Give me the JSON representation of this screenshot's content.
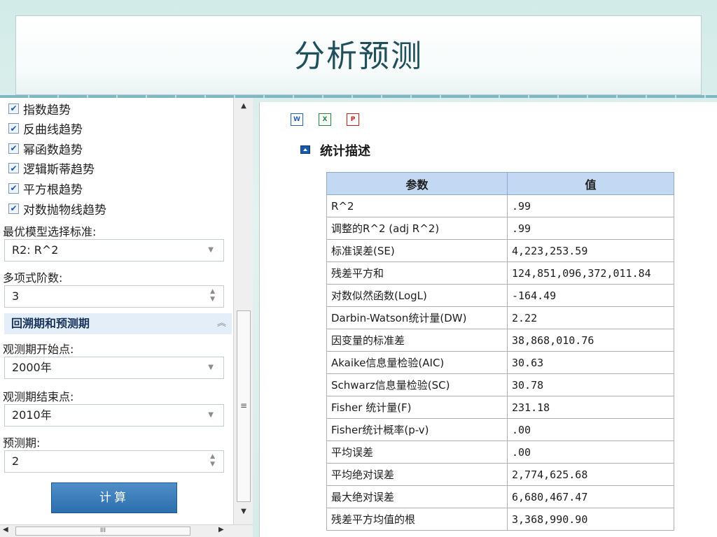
{
  "slide": {
    "title": "分析预测"
  },
  "left_panel": {
    "checkboxes": [
      {
        "label": "指数趋势",
        "checked": true
      },
      {
        "label": "反曲线趋势",
        "checked": true
      },
      {
        "label": "幂函数趋势",
        "checked": true
      },
      {
        "label": "逻辑斯蒂趋势",
        "checked": true
      },
      {
        "label": "平方根趋势",
        "checked": true
      },
      {
        "label": "对数抛物线趋势",
        "checked": true
      }
    ],
    "criteria_label": "最优模型选择标准:",
    "criteria_value": "R2: R^2",
    "poly_label": "多项式阶数:",
    "poly_value": "3",
    "section_title": "回溯期和预测期",
    "obs_start_label": "观测期开始点:",
    "obs_start_value": "2000年",
    "obs_end_label": "观测期结束点:",
    "obs_end_value": "2010年",
    "forecast_label": "预测期:",
    "forecast_value": "2",
    "calc_button": "计算"
  },
  "scrollbar": {
    "grip": "≡",
    "hgrip": "III"
  },
  "right_panel": {
    "export_icons": [
      {
        "name": "word-export-icon",
        "glyph": "W",
        "color": "#2b5eb0"
      },
      {
        "name": "excel-export-icon",
        "glyph": "X",
        "color": "#1e8a3c"
      },
      {
        "name": "pdf-export-icon",
        "glyph": "P",
        "color": "#c8201c"
      }
    ],
    "section_title": "统计描述",
    "table": {
      "headers": [
        "参数",
        "值"
      ],
      "rows": [
        [
          "R^2",
          ".99"
        ],
        [
          "调整的R^2 (adj R^2)",
          ".99"
        ],
        [
          "标准误差(SE)",
          "4,223,253.59"
        ],
        [
          "残差平方和",
          "124,851,096,372,011.84"
        ],
        [
          "对数似然函数(LogL)",
          "-164.49"
        ],
        [
          "Darbin-Watson统计量(DW)",
          "2.22"
        ],
        [
          "因变量的标准差",
          "38,868,010.76"
        ],
        [
          "Akaike信息量检验(AIC)",
          "30.63"
        ],
        [
          "Schwarz信息量检验(SC)",
          "30.78"
        ],
        [
          "Fisher 统计量(F)",
          "231.18"
        ],
        [
          "Fisher统计概率(p-v)",
          ".00"
        ],
        [
          "平均误差",
          ".00"
        ],
        [
          "平均绝对误差",
          "2,774,625.68"
        ],
        [
          "最大绝对误差",
          "6,680,467.47"
        ],
        [
          "残差平方均值的根",
          "3,368,990.90"
        ]
      ]
    }
  }
}
